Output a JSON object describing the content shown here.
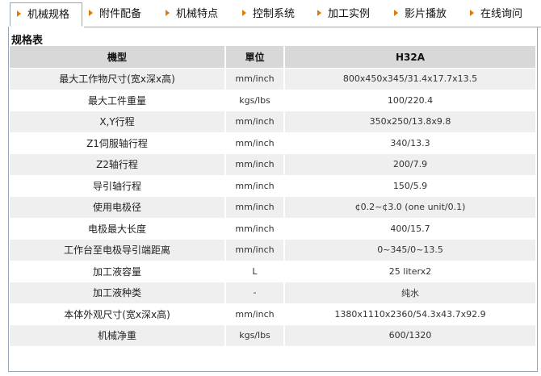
{
  "tabs": [
    {
      "label": "机械规格",
      "active": true
    },
    {
      "label": "附件配备",
      "active": false
    },
    {
      "label": "机械特点",
      "active": false
    },
    {
      "label": "控制系统",
      "active": false
    },
    {
      "label": "加工实例",
      "active": false
    },
    {
      "label": "影片播放",
      "active": false
    },
    {
      "label": "在线询问",
      "active": false
    }
  ],
  "section_title": "规格表",
  "table": {
    "headers": [
      "機型",
      "單位",
      "H32A"
    ],
    "rows": [
      {
        "name": "最大工作物尺寸(宽x深x高)",
        "unit": "mm/inch",
        "value": "800x450x345/31.4x17.7x13.5"
      },
      {
        "name": "最大工件重量",
        "unit": "kgs/lbs",
        "value": "100/220.4"
      },
      {
        "name": "X,Y行程",
        "unit": "mm/inch",
        "value": "350x250/13.8x9.8"
      },
      {
        "name": "Z1伺服轴行程",
        "unit": "mm/inch",
        "value": "340/13.3"
      },
      {
        "name": "Z2轴行程",
        "unit": "mm/inch",
        "value": "200/7.9"
      },
      {
        "name": "导引轴行程",
        "unit": "mm/inch",
        "value": "150/5.9"
      },
      {
        "name": "使用电极径",
        "unit": "mm/inch",
        "value": "¢0.2~¢3.0 (one unit/0.1)"
      },
      {
        "name": "电极最大长度",
        "unit": "mm/inch",
        "value": "400/15.7"
      },
      {
        "name": "工作台至电极导引端距离",
        "unit": "mm/inch",
        "value": "0~345/0~13.5"
      },
      {
        "name": "加工液容量",
        "unit": "L",
        "value": "25 literx2"
      },
      {
        "name": "加工液种类",
        "unit": "-",
        "value": "纯水"
      },
      {
        "name": "本体外观尺寸(宽x深x高)",
        "unit": "mm/inch",
        "value": "1380x1110x2360/54.3x43.7x92.9"
      },
      {
        "name": "机械净重",
        "unit": "kgs/lbs",
        "value": "600/1320"
      }
    ]
  },
  "colors": {
    "tab_arrow": "#e07b00",
    "border": "#9aa7b8",
    "header_bg": "#d8d8d8",
    "row_alt": "#efefef"
  }
}
